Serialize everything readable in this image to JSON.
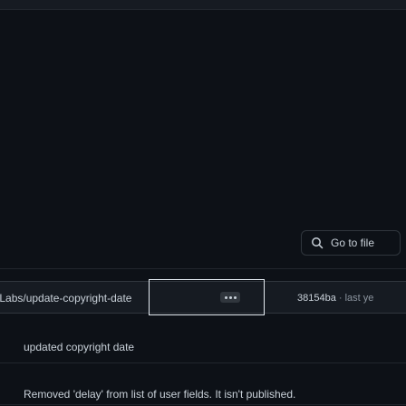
{
  "search": {
    "label": "Go to file",
    "icon": "search-icon"
  },
  "context_bar": {
    "branch_path": "toddLabs/update-copyright-date",
    "more_icon": "ellipsis-icon",
    "commit_sha": "38154ba",
    "commit_meta_rest": " · last ye"
  },
  "commit": {
    "title": "updated copyright date",
    "description": "Removed 'delay' from list of user fields. It isn't published."
  },
  "colors": {
    "background": "#0d1117",
    "bar": "#161b22",
    "border": "#30363d",
    "text": "#c9d1d9",
    "muted": "#8b949e"
  }
}
